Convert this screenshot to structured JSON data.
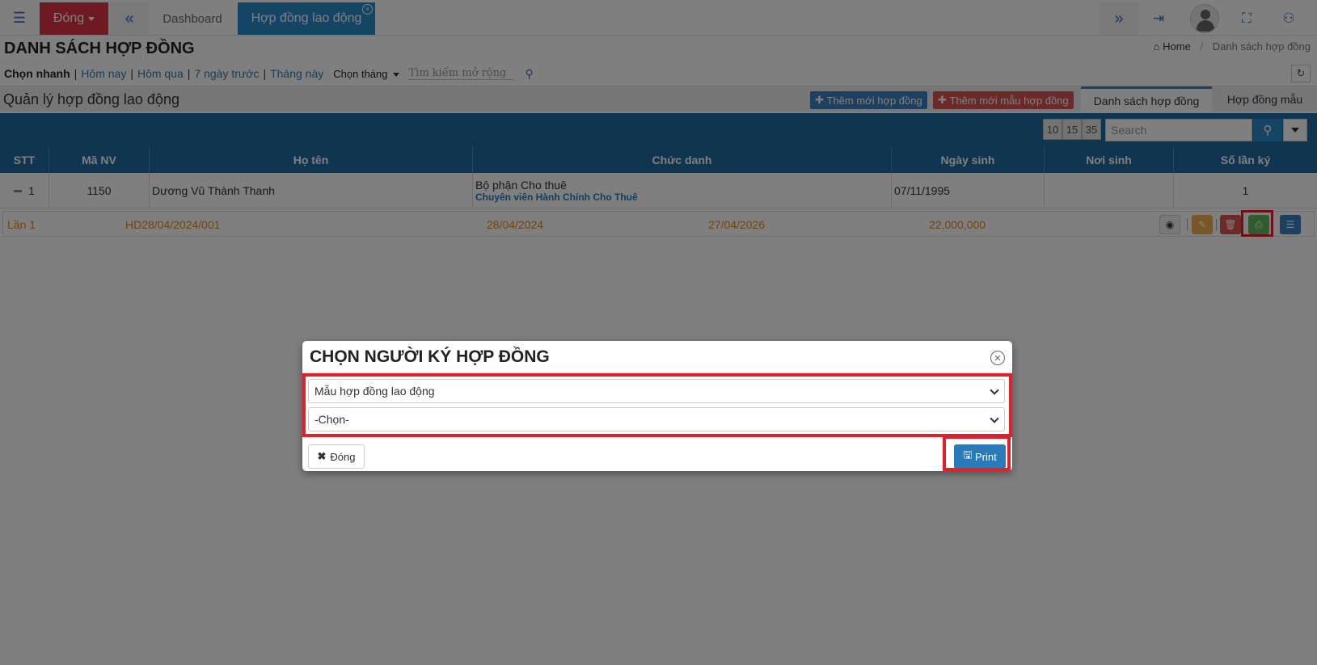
{
  "topbar": {
    "menu_icon": "☰",
    "dong_label": "Đóng",
    "back_icon": "«",
    "tab_dashboard": "Dashboard",
    "tab_active": "Hợp đồng lao động",
    "tab_close_icon": "×",
    "forward_icon": "»",
    "logout_icon": "⇥",
    "fullscreen_icon": "⛶",
    "tree_icon": "⚇"
  },
  "header": {
    "title": "DANH SÁCH HỢP ĐỒNG",
    "breadcrumb_home": "Home",
    "breadcrumb_current": "Danh sách hợp đồng"
  },
  "quickbar": {
    "lead": "Chọn nhanh",
    "links": [
      "Hôm nay",
      "Hôm qua",
      "7 ngày trước",
      "Tháng này"
    ],
    "month_label": "Chọn tháng",
    "search_placeholder": "Tìm kiếm mở rộng"
  },
  "section": {
    "title": "Quản lý hợp đồng lao động",
    "add_contract": "Thêm mới hợp đồng",
    "add_template": "Thêm mới mẫu hợp đồng",
    "tab_list": "Danh sách hợp đồng",
    "tab_template": "Hợp đồng mẫu"
  },
  "table": {
    "page_sizes": [
      "10",
      "15",
      "35"
    ],
    "search_placeholder": "Search",
    "columns": [
      "STT",
      "Mã NV",
      "Họ tên",
      "Chức danh",
      "Ngày sinh",
      "Nơi sinh",
      "Số lần ký"
    ],
    "rows": [
      {
        "stt": "1",
        "ma_nv": "1150",
        "ho_ten": "Dương Vũ Thành Thanh",
        "department": "Bộ phận Cho thuê",
        "position": "Chuyên viên Hành Chính Cho Thuê",
        "ngay_sinh": "07/11/1995",
        "noi_sinh": "",
        "so_lan_ky": "1"
      }
    ],
    "sub_row": {
      "lan": "Lần 1",
      "code": "HD28/04/2024/001",
      "start": "28/04/2024",
      "end": "27/04/2026",
      "amount": "22,000,000"
    }
  },
  "modal": {
    "title": "CHỌN NGƯỜI KÝ HỢP ĐỒNG",
    "select_template": "Mẫu hợp đồng lao động",
    "select_signer": "-Chọn-",
    "close_label": "Đóng",
    "print_label": "Print"
  },
  "colors": {
    "primary": "#2a8bc9",
    "header_blue": "#1f6aa3",
    "danger": "#dc3545",
    "highlight": "#e0202a",
    "orange_text": "#e08a1e"
  }
}
